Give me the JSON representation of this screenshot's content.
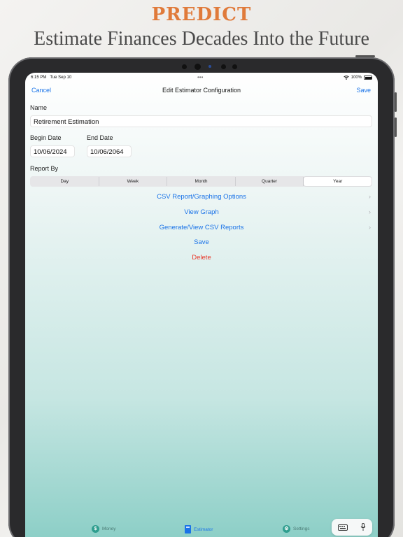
{
  "promo": {
    "headline": "PREDICT",
    "subhead": "Estimate Finances Decades Into the Future"
  },
  "status_bar": {
    "time": "6:15 PM",
    "date": "Tue Sep 10",
    "dots": "•••",
    "battery": "100%"
  },
  "navbar": {
    "cancel_label": "Cancel",
    "title": "Edit Estimator Configuration",
    "save_label": "Save"
  },
  "form": {
    "name_label": "Name",
    "name_value": "Retirement Estimation",
    "begin_date_label": "Begin Date",
    "begin_date_value": "10/06/2024",
    "end_date_label": "End Date",
    "end_date_value": "10/06/2064",
    "report_by_label": "Report By",
    "report_by_options": [
      "Day",
      "Week",
      "Month",
      "Quarter",
      "Year"
    ],
    "report_by_selected": "Year"
  },
  "actions": {
    "csv_options": "CSV Report/Graphing Options",
    "view_graph": "View Graph",
    "csv_reports": "Generate/View CSV Reports",
    "save": "Save",
    "delete": "Delete"
  },
  "tabbar": {
    "money": "Money",
    "estimator": "Estimator",
    "settings": "Settings"
  },
  "icons": {
    "chevron": "chevron-right-icon",
    "money": "dollar-circle-icon",
    "estimator": "calculator-icon",
    "settings": "gear-icon",
    "keyboard": "keyboard-icon",
    "mic": "microphone-icon"
  },
  "colors": {
    "accent": "#1a73e8",
    "delete": "#e8392b",
    "headline": "#e07a3a"
  }
}
